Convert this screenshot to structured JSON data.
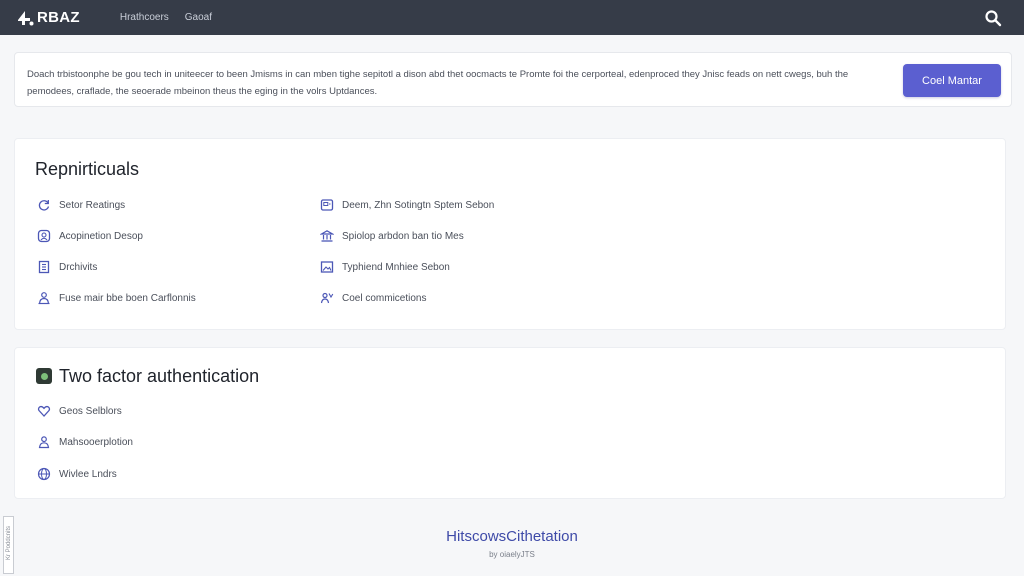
{
  "brand": {
    "name": "RBAZ"
  },
  "nav": [
    "Hrathcoers",
    "Gaoaf"
  ],
  "banner": {
    "text": "Doach trbistoonphe be gou tech in uniteecer to been Jmisms in can mben tighe sepitotl a dison abd thet oocmacts te Promte foi the cerporteal, edenproced they Jnisc feads on nett cwegs, buh the pemodees, craflade, the seoerade mbeinon theus the eging in the volrs Uptdances.",
    "button": "Coel Mantar"
  },
  "section1": {
    "title": "Repnirticuals",
    "items_left": [
      {
        "label": "Setor Reatings",
        "icon": "refresh-icon"
      },
      {
        "label": "Acopinetion Desop",
        "icon": "badge-icon"
      },
      {
        "label": "Drchivits",
        "icon": "building-icon"
      },
      {
        "label": "Fuse mair bbe boen Carflonnis",
        "icon": "person-icon"
      }
    ],
    "items_right": [
      {
        "label": "Deem, Zhn Sotingtn Sptem Sebon",
        "icon": "panel-icon"
      },
      {
        "label": "Spiolop arbdon ban tio Mes",
        "icon": "bank-icon"
      },
      {
        "label": "Typhiend Mnhiee Sebon",
        "icon": "image-icon"
      },
      {
        "label": "Coel commicetions",
        "icon": "users-icon"
      }
    ]
  },
  "section2": {
    "title": "Two factor authentication",
    "items": [
      {
        "label": "Geos Selblors",
        "icon": "heart-icon"
      },
      {
        "label": "Mahsooerplotion",
        "icon": "user-icon"
      },
      {
        "label": "Wivlee Lndrs",
        "icon": "globe-icon"
      }
    ]
  },
  "footer": {
    "brand": "HitscowsCithetation",
    "by": "by oiaelyJTS"
  },
  "side_tag": "Kr Poddcnits",
  "colors": {
    "topbar": "#363c48",
    "accent_button": "#5b5fd0",
    "footer_brand": "#3e4aa8",
    "icon_stroke": "#4c57b6"
  }
}
